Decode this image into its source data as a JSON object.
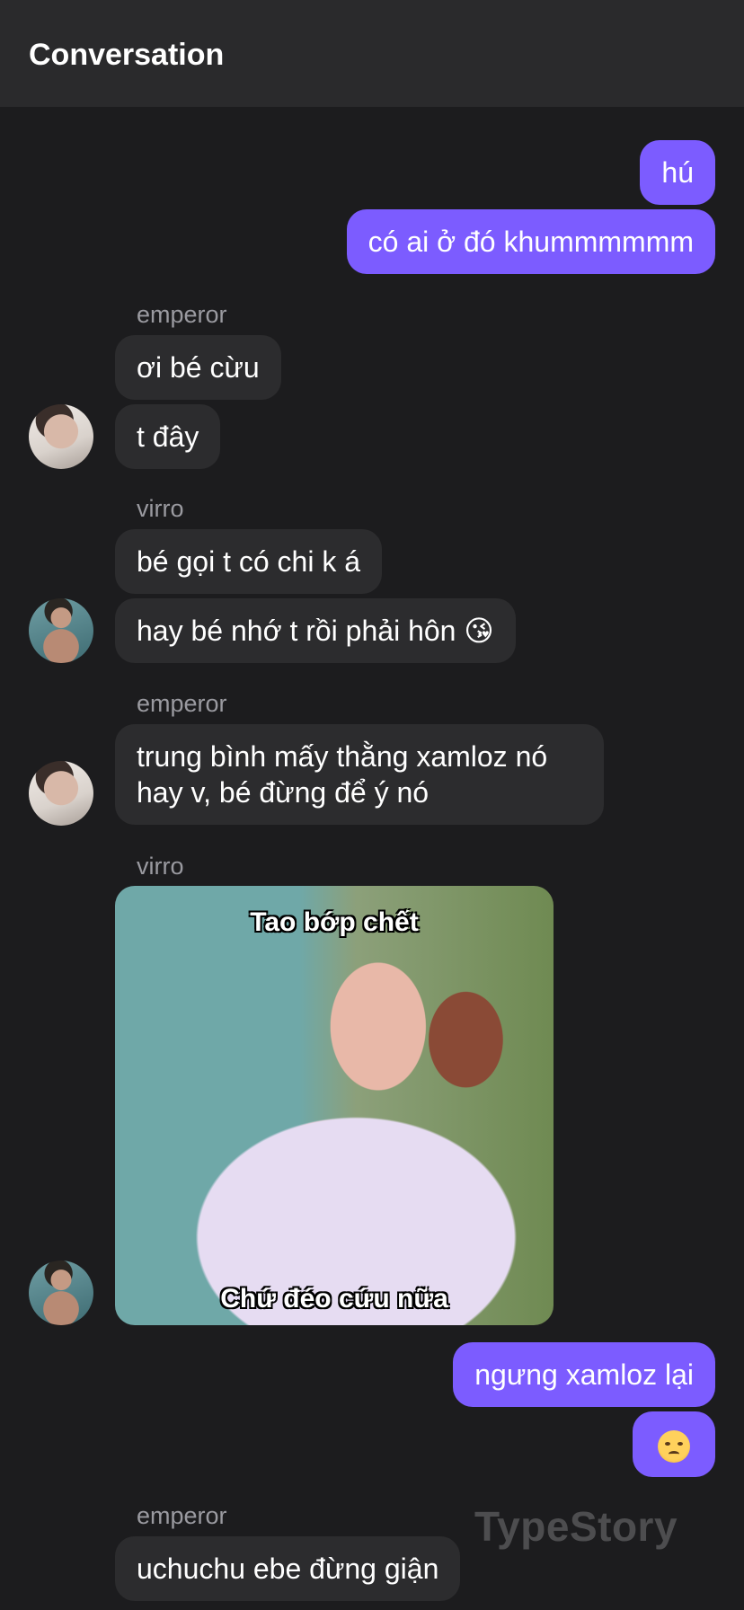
{
  "header": {
    "title": "Conversation"
  },
  "messages": {
    "m1": "hú",
    "m2": "có ai ở đó khummmmmm",
    "s1": "emperor",
    "m3": "ơi bé cừu",
    "m4": "t đây",
    "s2": "virro",
    "m5": "bé gọi t có chi k á",
    "m6": "hay bé nhớ t rồi phải hôn 😘",
    "s3": "emperor",
    "m7": "trung bình mấy thằng xamloz nó hay v, bé đừng để ý nó",
    "s4": "virro",
    "meme_top": "Tao bớp chết",
    "meme_bottom": "Chứ đéo cứu nữa",
    "m8": "ngưng xamloz lại",
    "m9_icon": "angry-face-icon",
    "s5": "emperor",
    "m10": "uchuchu ebe đừng giận"
  },
  "watermark": "TypeStory",
  "colors": {
    "outgoing_bubble": "#7c5cff",
    "incoming_bubble": "#2c2c2e",
    "background": "#1c1c1e",
    "header": "#2a2a2c"
  }
}
